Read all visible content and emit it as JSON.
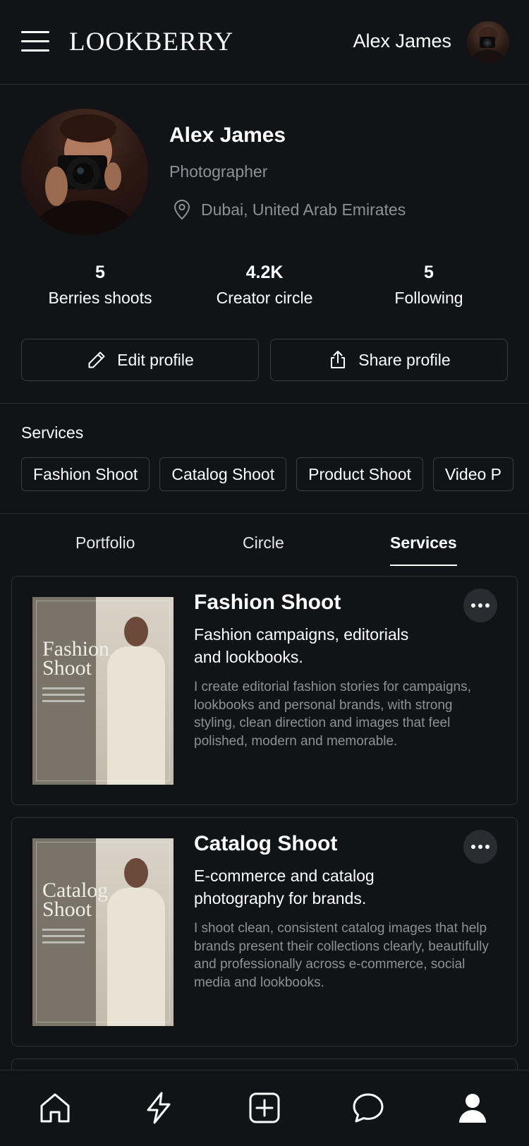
{
  "header": {
    "brand": "LOOKBERRY",
    "user_name": "Alex James",
    "menu_icon": "hamburger-menu-icon",
    "avatar": "user-avatar"
  },
  "profile": {
    "name": "Alex James",
    "role": "Photographer",
    "location": "Dubai, United Arab Emirates",
    "location_icon": "map-pin-icon"
  },
  "stats": [
    {
      "value": "5",
      "label": "Berries shoots"
    },
    {
      "value": "4.2K",
      "label": "Creator circle"
    },
    {
      "value": "5",
      "label": "Following"
    }
  ],
  "actions": {
    "edit_label": "Edit profile",
    "share_label": "Share profile",
    "edit_icon": "pencil-icon",
    "share_icon": "share-icon"
  },
  "services_section": {
    "title": "Services",
    "chips": [
      "Fashion Shoot",
      "Catalog Shoot",
      "Product Shoot",
      "Video P"
    ]
  },
  "tabs": [
    {
      "label": "Portfolio",
      "active": false
    },
    {
      "label": "Circle",
      "active": false
    },
    {
      "label": "Services",
      "active": true
    }
  ],
  "cards": [
    {
      "title": "Fashion Shoot",
      "subtitle": "Fashion campaigns, editorials and lookbooks.",
      "description": "I create editorial fashion stories for campaigns, lookbooks and personal brands, with strong styling, clean direction and images that feel polished, modern and memorable.",
      "thumb_title": "Fashion Shoot"
    },
    {
      "title": "Catalog Shoot",
      "subtitle": "E-commerce and catalog photography for brands.",
      "description": "I shoot clean, consistent catalog images that help brands present their collections clearly, beautifully and professionally across e-commerce, social media and lookbooks.",
      "thumb_title": "Catalog Shoot"
    }
  ],
  "bottom_nav": [
    "home-icon",
    "flash-icon",
    "add-square-icon",
    "chat-bubble-icon",
    "profile-icon"
  ],
  "colors": {
    "background": "#121317",
    "border": "#2e3036",
    "muted_text": "#8e9097",
    "text": "#ffffff"
  }
}
